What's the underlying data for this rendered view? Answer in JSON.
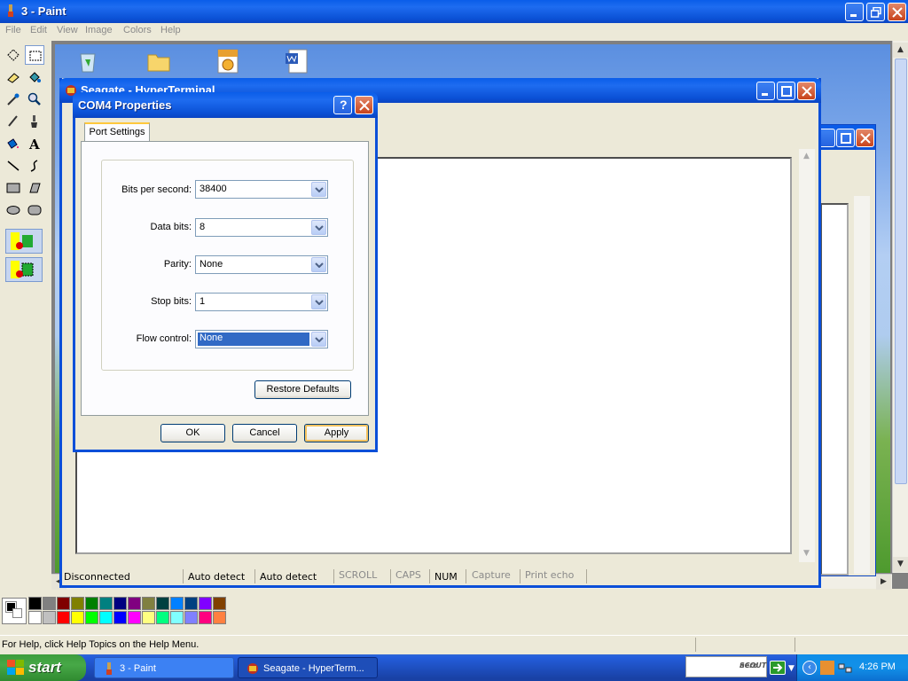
{
  "paint": {
    "title": "3 - Paint",
    "menu": [
      "File",
      "Edit",
      "View",
      "Image",
      "Colors",
      "Help"
    ],
    "status_text": "For Help, click Help Topics on the Help Menu.",
    "palette_top": [
      "#000000",
      "#808080",
      "#800000",
      "#808000",
      "#008000",
      "#008080",
      "#000080",
      "#800080",
      "#808040",
      "#004040",
      "#0080FF",
      "#004080",
      "#8000FF",
      "#804000"
    ],
    "palette_bottom": [
      "#FFFFFF",
      "#C0C0C0",
      "#FF0000",
      "#FFFF00",
      "#00FF00",
      "#00FFFF",
      "#0000FF",
      "#FF00FF",
      "#FFFF80",
      "#00FF80",
      "#80FFFF",
      "#8080FF",
      "#FF0080",
      "#FF8040"
    ]
  },
  "hyperterminal": {
    "title": "Seagate - HyperTerminal",
    "status": {
      "connection": "Disconnected",
      "detect1": "Auto detect",
      "detect2": "Auto detect",
      "scroll": "SCROLL",
      "caps": "CAPS",
      "num": "NUM",
      "capture": "Capture",
      "print_echo": "Print echo"
    }
  },
  "dialog": {
    "title": "COM4 Properties",
    "tab": "Port Settings",
    "fields": {
      "bits_label": "Bits per second:",
      "bits_value": "38400",
      "data_label": "Data bits:",
      "data_value": "8",
      "parity_label": "Parity:",
      "parity_value": "None",
      "stop_label": "Stop bits:",
      "stop_value": "1",
      "flow_label": "Flow control:",
      "flow_value": "None"
    },
    "restore_label": "Restore Defaults",
    "ok_label": "OK",
    "cancel_label": "Cancel",
    "apply_label": "Apply"
  },
  "taskbar": {
    "start_label": "start",
    "tasks": [
      "3 - Paint",
      "Seagate - HyperTerm..."
    ],
    "nero_label_1": "nero",
    "nero_label_2": "SCOUT",
    "clock": "4:26 PM"
  }
}
